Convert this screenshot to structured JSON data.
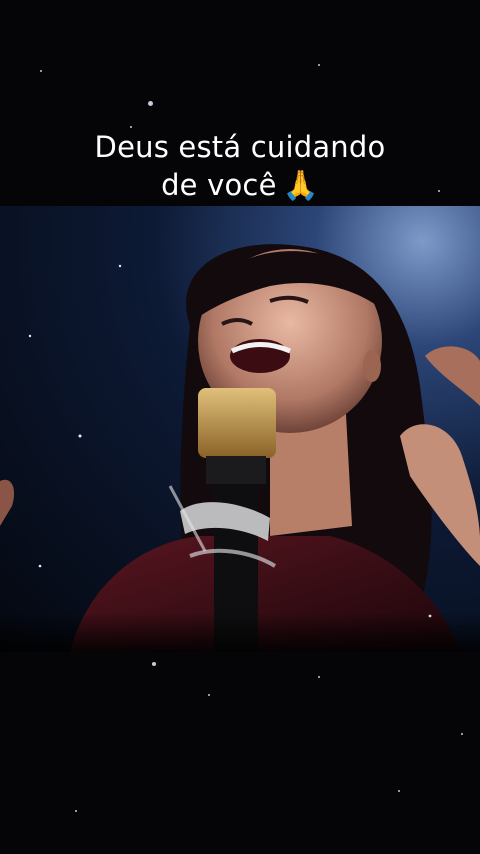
{
  "caption": {
    "line1": "Deus está cuidando",
    "line2": "de você",
    "emoji": "🙏"
  },
  "media": {
    "description_icon": "singer-with-microphone-image"
  },
  "colors": {
    "background": "#050507",
    "text": "#ffffff",
    "stage_light": "#7d9ac9",
    "microphone_gold": "#c9a24a"
  }
}
